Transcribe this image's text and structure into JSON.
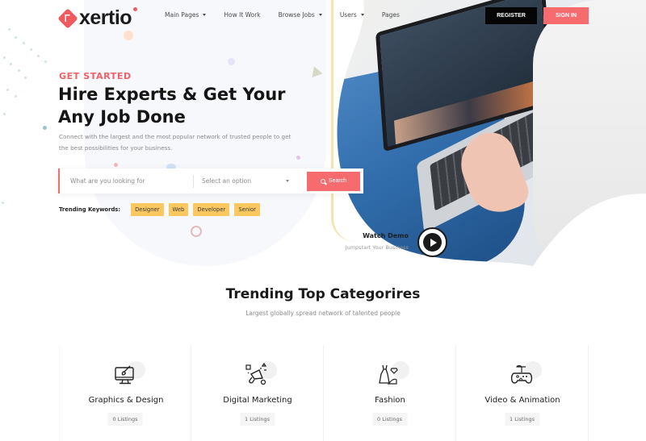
{
  "brand": {
    "logo_text": "xertio",
    "accent_color": "#f56b6e",
    "tag_color": "#fbc85f"
  },
  "nav": {
    "items": [
      {
        "label": "Main Pages",
        "has_dropdown": true
      },
      {
        "label": "How It Work",
        "has_dropdown": false
      },
      {
        "label": "Browse Jobs",
        "has_dropdown": true
      },
      {
        "label": "Users",
        "has_dropdown": true
      },
      {
        "label": "Pages",
        "has_dropdown": false
      }
    ],
    "register_label": "REGISTER",
    "signin_label": "SIGN IN"
  },
  "hero": {
    "eyebrow": "GET STARTED",
    "title": "Hire Experts & Get Your Any Job Done",
    "description": "Connect with the largest and the most popular network of trusted people to get the best possibilities for your business.",
    "search": {
      "placeholder": "What are you looking for",
      "select_value": "Select an option",
      "button_label": "Search"
    },
    "trending": {
      "label": "Trending Keywords:",
      "keywords": [
        "Designer",
        "Web",
        "Developer",
        "Senior"
      ]
    },
    "demo": {
      "title": "Watch Demo",
      "subtitle": "Jumpstart Your Business"
    }
  },
  "categories": {
    "title": "Trending Top Categorires",
    "subtitle": "Largest globally spread network of talented people",
    "items": [
      {
        "name": "Graphics & Design",
        "count": "0 Listings",
        "icon": "monitor-brush-icon"
      },
      {
        "name": "Digital Marketing",
        "count": "1 Listings",
        "icon": "megaphone-icon"
      },
      {
        "name": "Fashion",
        "count": "0 Listings",
        "icon": "dress-icon"
      },
      {
        "name": "Video & Animation",
        "count": "1 Listings",
        "icon": "gamepad-icon"
      }
    ]
  }
}
